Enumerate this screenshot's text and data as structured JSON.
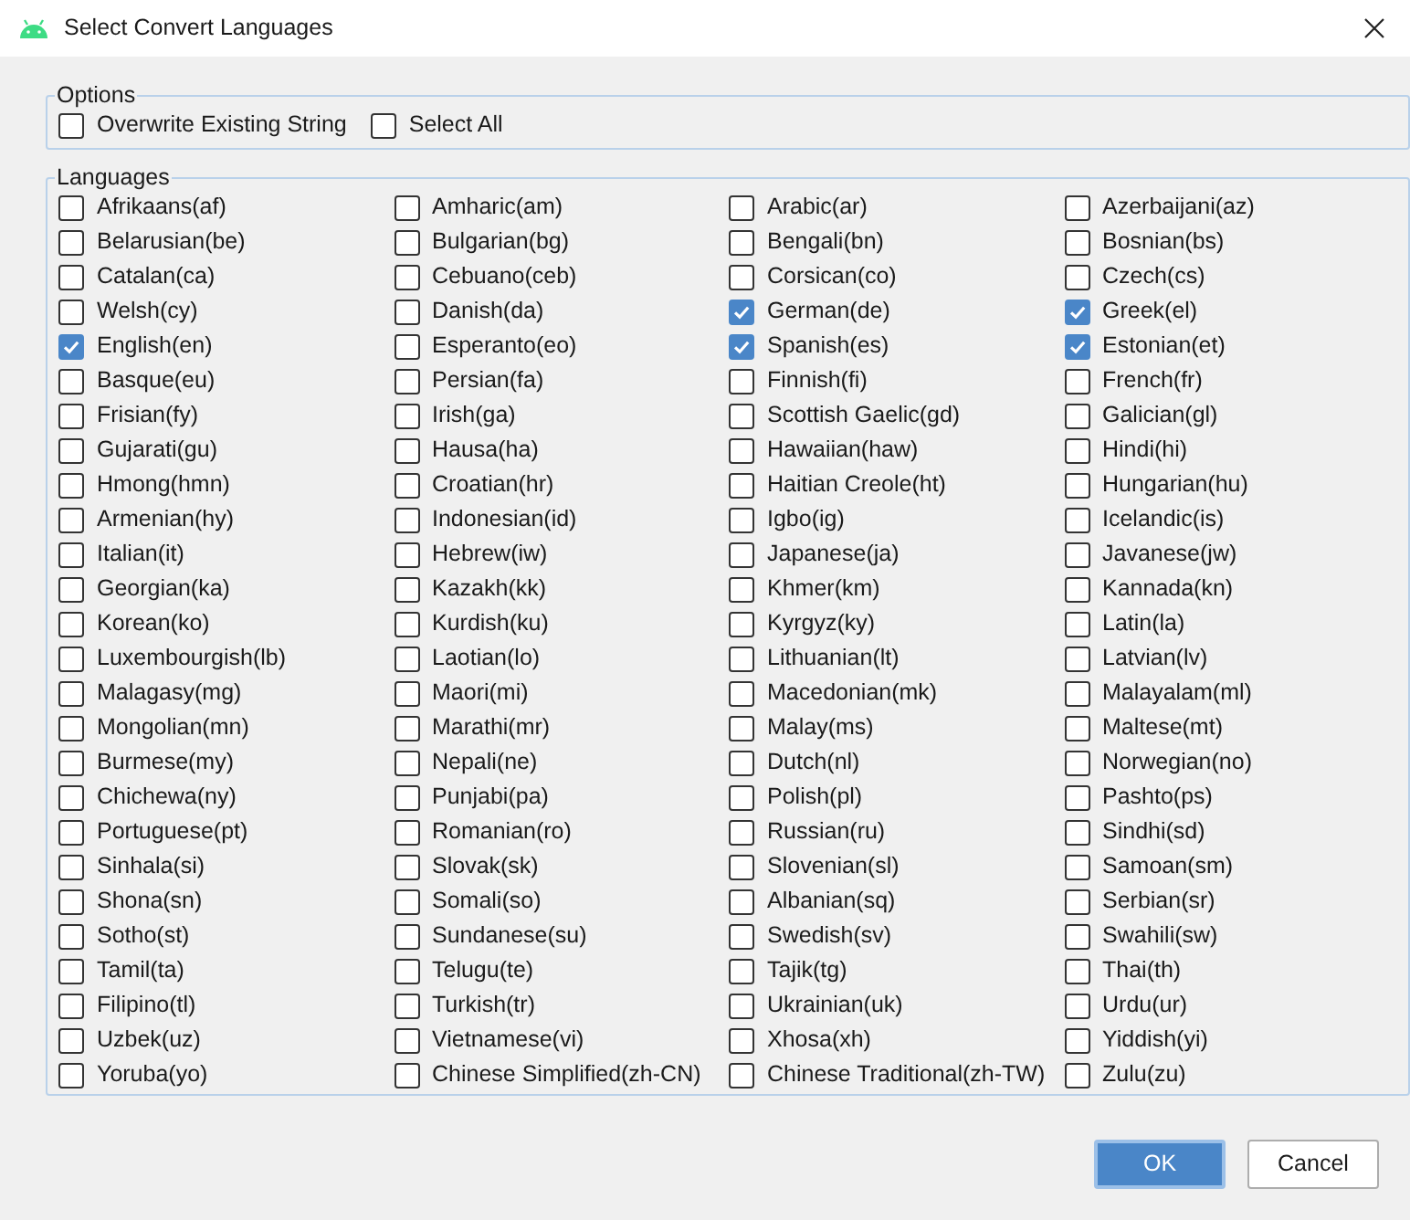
{
  "window": {
    "title": "Select Convert Languages"
  },
  "options": {
    "title": "Options",
    "items": [
      {
        "label": "Overwrite Existing String",
        "checked": false
      },
      {
        "label": "Select All",
        "checked": false
      }
    ]
  },
  "languages": {
    "title": "Languages",
    "items": [
      {
        "label": "Afrikaans(af)",
        "checked": false
      },
      {
        "label": "Amharic(am)",
        "checked": false
      },
      {
        "label": "Arabic(ar)",
        "checked": false
      },
      {
        "label": "Azerbaijani(az)",
        "checked": false
      },
      {
        "label": "Belarusian(be)",
        "checked": false
      },
      {
        "label": "Bulgarian(bg)",
        "checked": false
      },
      {
        "label": "Bengali(bn)",
        "checked": false
      },
      {
        "label": "Bosnian(bs)",
        "checked": false
      },
      {
        "label": "Catalan(ca)",
        "checked": false
      },
      {
        "label": "Cebuano(ceb)",
        "checked": false
      },
      {
        "label": "Corsican(co)",
        "checked": false
      },
      {
        "label": "Czech(cs)",
        "checked": false
      },
      {
        "label": "Welsh(cy)",
        "checked": false
      },
      {
        "label": "Danish(da)",
        "checked": false
      },
      {
        "label": "German(de)",
        "checked": true
      },
      {
        "label": "Greek(el)",
        "checked": true
      },
      {
        "label": "English(en)",
        "checked": true
      },
      {
        "label": "Esperanto(eo)",
        "checked": false
      },
      {
        "label": "Spanish(es)",
        "checked": true
      },
      {
        "label": "Estonian(et)",
        "checked": true
      },
      {
        "label": "Basque(eu)",
        "checked": false
      },
      {
        "label": "Persian(fa)",
        "checked": false
      },
      {
        "label": "Finnish(fi)",
        "checked": false
      },
      {
        "label": "French(fr)",
        "checked": false
      },
      {
        "label": "Frisian(fy)",
        "checked": false
      },
      {
        "label": "Irish(ga)",
        "checked": false
      },
      {
        "label": "Scottish Gaelic(gd)",
        "checked": false
      },
      {
        "label": "Galician(gl)",
        "checked": false
      },
      {
        "label": "Gujarati(gu)",
        "checked": false
      },
      {
        "label": "Hausa(ha)",
        "checked": false
      },
      {
        "label": "Hawaiian(haw)",
        "checked": false
      },
      {
        "label": "Hindi(hi)",
        "checked": false
      },
      {
        "label": "Hmong(hmn)",
        "checked": false
      },
      {
        "label": "Croatian(hr)",
        "checked": false
      },
      {
        "label": "Haitian Creole(ht)",
        "checked": false
      },
      {
        "label": "Hungarian(hu)",
        "checked": false
      },
      {
        "label": "Armenian(hy)",
        "checked": false
      },
      {
        "label": "Indonesian(id)",
        "checked": false
      },
      {
        "label": "Igbo(ig)",
        "checked": false
      },
      {
        "label": "Icelandic(is)",
        "checked": false
      },
      {
        "label": "Italian(it)",
        "checked": false
      },
      {
        "label": "Hebrew(iw)",
        "checked": false
      },
      {
        "label": "Japanese(ja)",
        "checked": false
      },
      {
        "label": "Javanese(jw)",
        "checked": false
      },
      {
        "label": "Georgian(ka)",
        "checked": false
      },
      {
        "label": "Kazakh(kk)",
        "checked": false
      },
      {
        "label": "Khmer(km)",
        "checked": false
      },
      {
        "label": "Kannada(kn)",
        "checked": false
      },
      {
        "label": "Korean(ko)",
        "checked": false
      },
      {
        "label": "Kurdish(ku)",
        "checked": false
      },
      {
        "label": "Kyrgyz(ky)",
        "checked": false
      },
      {
        "label": "Latin(la)",
        "checked": false
      },
      {
        "label": "Luxembourgish(lb)",
        "checked": false
      },
      {
        "label": "Laotian(lo)",
        "checked": false
      },
      {
        "label": "Lithuanian(lt)",
        "checked": false
      },
      {
        "label": "Latvian(lv)",
        "checked": false
      },
      {
        "label": "Malagasy(mg)",
        "checked": false
      },
      {
        "label": "Maori(mi)",
        "checked": false
      },
      {
        "label": "Macedonian(mk)",
        "checked": false
      },
      {
        "label": "Malayalam(ml)",
        "checked": false
      },
      {
        "label": "Mongolian(mn)",
        "checked": false
      },
      {
        "label": "Marathi(mr)",
        "checked": false
      },
      {
        "label": "Malay(ms)",
        "checked": false
      },
      {
        "label": "Maltese(mt)",
        "checked": false
      },
      {
        "label": "Burmese(my)",
        "checked": false
      },
      {
        "label": "Nepali(ne)",
        "checked": false
      },
      {
        "label": "Dutch(nl)",
        "checked": false
      },
      {
        "label": "Norwegian(no)",
        "checked": false
      },
      {
        "label": "Chichewa(ny)",
        "checked": false
      },
      {
        "label": "Punjabi(pa)",
        "checked": false
      },
      {
        "label": "Polish(pl)",
        "checked": false
      },
      {
        "label": "Pashto(ps)",
        "checked": false
      },
      {
        "label": "Portuguese(pt)",
        "checked": false
      },
      {
        "label": "Romanian(ro)",
        "checked": false
      },
      {
        "label": "Russian(ru)",
        "checked": false
      },
      {
        "label": "Sindhi(sd)",
        "checked": false
      },
      {
        "label": "Sinhala(si)",
        "checked": false
      },
      {
        "label": "Slovak(sk)",
        "checked": false
      },
      {
        "label": "Slovenian(sl)",
        "checked": false
      },
      {
        "label": "Samoan(sm)",
        "checked": false
      },
      {
        "label": "Shona(sn)",
        "checked": false
      },
      {
        "label": "Somali(so)",
        "checked": false
      },
      {
        "label": "Albanian(sq)",
        "checked": false
      },
      {
        "label": "Serbian(sr)",
        "checked": false
      },
      {
        "label": "Sotho(st)",
        "checked": false
      },
      {
        "label": "Sundanese(su)",
        "checked": false
      },
      {
        "label": "Swedish(sv)",
        "checked": false
      },
      {
        "label": "Swahili(sw)",
        "checked": false
      },
      {
        "label": "Tamil(ta)",
        "checked": false
      },
      {
        "label": "Telugu(te)",
        "checked": false
      },
      {
        "label": "Tajik(tg)",
        "checked": false
      },
      {
        "label": "Thai(th)",
        "checked": false
      },
      {
        "label": "Filipino(tl)",
        "checked": false
      },
      {
        "label": "Turkish(tr)",
        "checked": false
      },
      {
        "label": "Ukrainian(uk)",
        "checked": false
      },
      {
        "label": "Urdu(ur)",
        "checked": false
      },
      {
        "label": "Uzbek(uz)",
        "checked": false
      },
      {
        "label": "Vietnamese(vi)",
        "checked": false
      },
      {
        "label": "Xhosa(xh)",
        "checked": false
      },
      {
        "label": "Yiddish(yi)",
        "checked": false
      },
      {
        "label": "Yoruba(yo)",
        "checked": false
      },
      {
        "label": "Chinese Simplified(zh-CN)",
        "checked": false
      },
      {
        "label": "Chinese Traditional(zh-TW)",
        "checked": false
      },
      {
        "label": "Zulu(zu)",
        "checked": false
      }
    ]
  },
  "buttons": [
    {
      "label": "OK",
      "kind": "primary"
    },
    {
      "label": "Cancel",
      "kind": "secondary"
    }
  ]
}
